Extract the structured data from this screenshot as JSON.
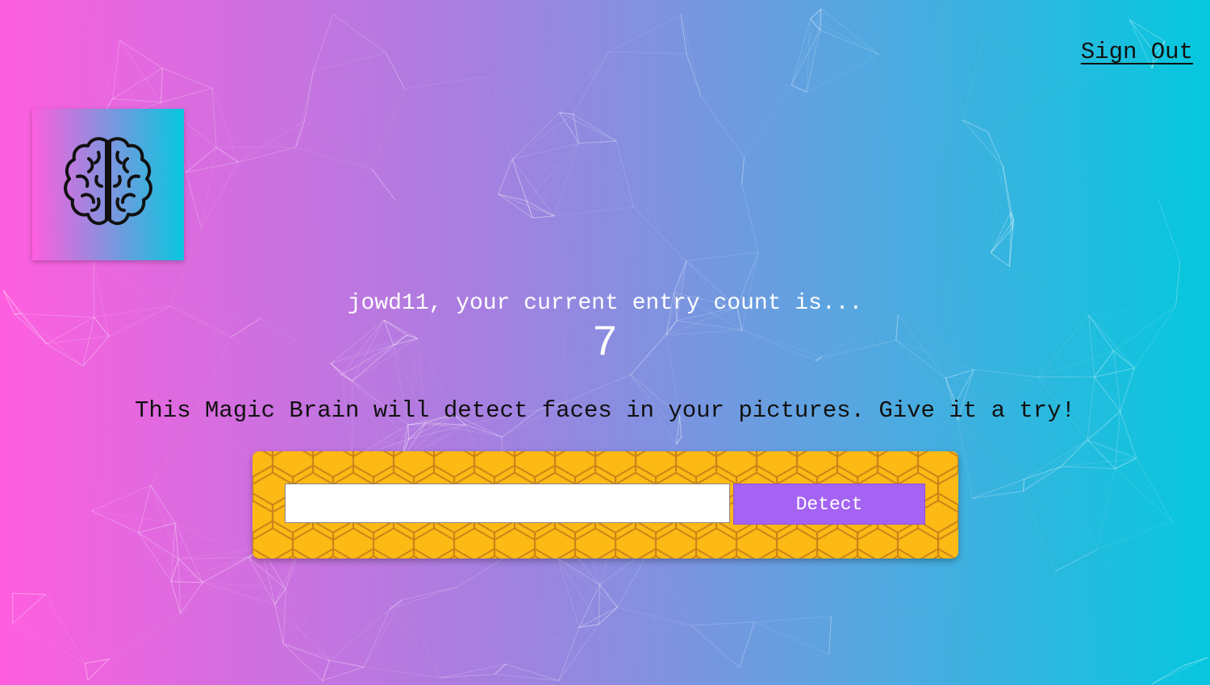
{
  "nav": {
    "sign_out_label": "Sign Out"
  },
  "logo": {
    "icon": "brain-icon"
  },
  "rank": {
    "message": "jowd11, your current entry count is...",
    "count": "7"
  },
  "intro": {
    "text": "This Magic Brain will detect faces in your pictures. Give it a try!"
  },
  "image_form": {
    "input_value": "",
    "input_placeholder": "",
    "detect_label": "Detect"
  },
  "colors": {
    "gradient_left": "#ff5edf",
    "gradient_right": "#04c8de",
    "form_background": "#fdb914",
    "hex_lines": "#c9851a",
    "detect_button": "#a463f2"
  }
}
